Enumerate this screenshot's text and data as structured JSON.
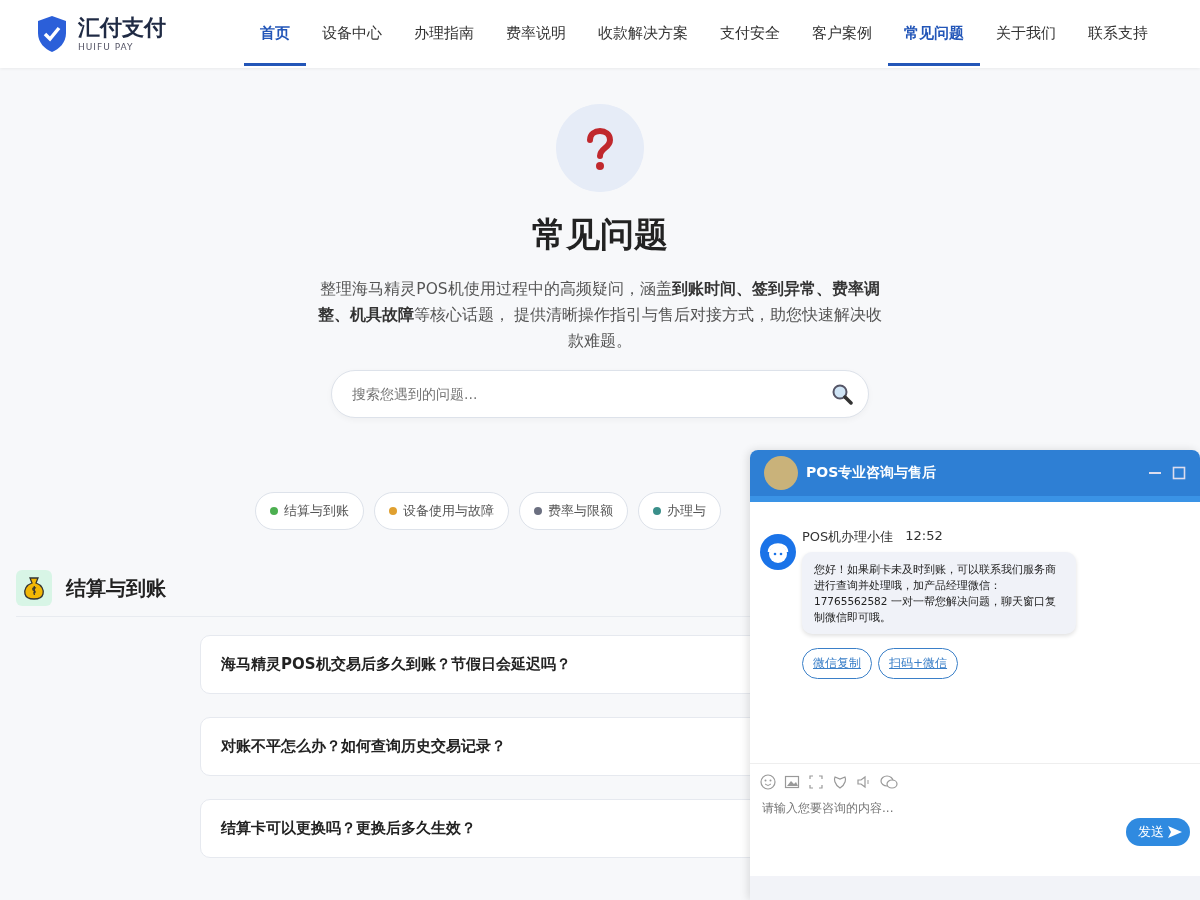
{
  "header": {
    "logo": {
      "name": "汇付支付",
      "subtitle": "HUIFU PAY"
    },
    "nav": [
      {
        "label": "首页",
        "selected": true
      },
      {
        "label": "设备中心",
        "selected": false
      },
      {
        "label": "办理指南",
        "selected": false
      },
      {
        "label": "费率说明",
        "selected": false
      },
      {
        "label": "收款解决方案",
        "selected": false
      },
      {
        "label": "支付安全",
        "selected": false
      },
      {
        "label": "客户案例",
        "selected": false
      },
      {
        "label": "常见问题",
        "selected": true
      },
      {
        "label": "关于我们",
        "selected": false
      },
      {
        "label": "联系支持",
        "selected": false
      }
    ]
  },
  "hero": {
    "title": "常见问题",
    "description": "整理海马精灵POS机使用过程中的高频疑问，涵盖**到账时间、签到异常、费率调整、机具故障**等核心话题， 提供清晰操作指引与售后对接方式，助您快速解决收款难题。",
    "search": {
      "placeholder": "搜索您遇到的问题..."
    }
  },
  "categories": [
    {
      "label": "结算与到账",
      "color": "#4caf50"
    },
    {
      "label": "设备使用与故障",
      "color": "#e0a030"
    },
    {
      "label": "费率与限额",
      "color": "#6b6f80"
    },
    {
      "label": "办理与",
      "color": "#3a8f8a"
    }
  ],
  "section": {
    "title": "结算与到账",
    "questions": [
      "海马精灵POS机交易后多久到账？节假日会延迟吗？",
      "对账不平怎么办？如何查询历史交易记录？",
      "结算卡可以更换吗？更换后多久生效？"
    ]
  },
  "chat": {
    "title": "POS专业咨询与售后",
    "message": {
      "sender": "POS机办理小佳",
      "time": "12:52",
      "text": "您好！如果刷卡未及时到账，可以联系我们服务商进行查询并处理哦，加产品经理微信：17765562582 一对一帮您解决问题，聊天窗口复制微信即可哦。"
    },
    "actions": [
      "微信复制",
      "扫码+微信"
    ],
    "input": {
      "placeholder": "请输入您要咨询的内容..."
    },
    "send": "发送"
  }
}
